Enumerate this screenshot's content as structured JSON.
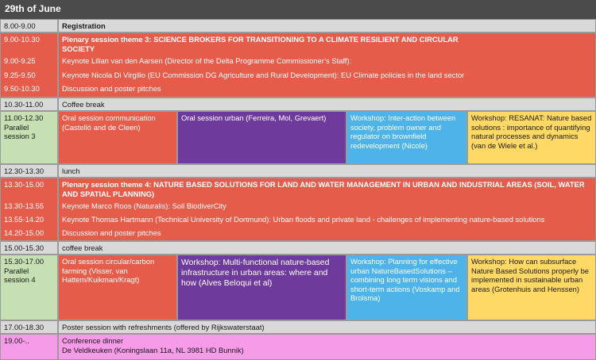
{
  "title": "29th of June",
  "colors": {
    "header": "#4b4b4b",
    "grey_row": "#d9d9d9",
    "plenary": "#e65c4a",
    "parallel_time": "#c6e0b4",
    "urban_session": "#6e3a9c",
    "workshop_blue": "#4db3e8",
    "workshop_yellow": "#ffd966",
    "dinner": "#f59be8"
  },
  "rows": {
    "registration": {
      "time": "8.00-9.00",
      "text": "Registration"
    },
    "plenary3": {
      "times": [
        "9.00-10.30",
        "9.00-9.25",
        "9.25-9.50",
        "9.50-10.30"
      ],
      "title": "Plenary session theme 3: SCIENCE BROKERS FOR TRANSITIONING TO A CLIMATE RESILIENT AND CIRCULAR SOCIETY",
      "items": [
        "Keynote Lilian van den Aarsen (Director of the Delta Programme Commissioner’s Staff):",
        "Keynote Nicola Di Virgilio (EU Commission DG Agriculture and Rural Development): EU Climate policies in the land sector",
        "Discussion and poster pitches"
      ]
    },
    "coffee1": {
      "time": "10.30-11.00",
      "text": "Coffee break"
    },
    "parallel3": {
      "time": "11.00-12.30",
      "label": "Parallel session 3",
      "cells": [
        "Oral session communication (Castelló and de Cleen)",
        "Oral session urban (Ferreira, Mol, Grevaert)",
        "Workshop: Inter-action between society, problem owner and regulator on brownfield redevelopment (Nicole)",
        "Workshop: RESANAT: Nature based solutions : importance of quantifying natural processes and dynamics (van de Wiele et al.)"
      ]
    },
    "lunch": {
      "time": "12.30-13.30",
      "text": "lunch"
    },
    "plenary4": {
      "times": [
        "13.30-15.00",
        "13.30-13.55",
        "13.55-14.20",
        "14.20-15.00"
      ],
      "title": "Plenary session theme 4: NATURE BASED SOLUTIONS FOR LAND AND WATER MANAGEMENT IN URBAN AND INDUSTRIAL AREAS (SOIL, WATER AND SPATIAL PLANNING)",
      "items": [
        "Keynote Marco Roos (Naturalis): Soil BiodiverCity",
        "Keynote Thomas Hartmann (Technical University of Dortmund): Urban floods and private land - challenges of implementing nature-based solutions",
        "Discussion and poster pitches"
      ]
    },
    "coffee2": {
      "time": "15.00-15.30",
      "text": "coffee break"
    },
    "parallel4": {
      "time": "15.30-17.00",
      "label": "Parallel session 4",
      "cells": [
        "Oral session circular/carbon farming (Visser, van Hattem/Kuikman/Kragt)",
        "Workshop: Multi-functional nature-based infrastructure in urban areas: where and how (Alves Beloqui et al)",
        "Workshop: Planning for effective urban NatureBasedSolutions – combining long term visions and short-term actions (Voskamp and Brolsma)",
        "Workshop: How can subsurface Nature Based Solutions properly be implemented in sustainable urban areas (Grotenhuis and Henssen)"
      ]
    },
    "poster": {
      "time": "17.00-18.30",
      "text": "Poster session with refreshments (offered by Rijkswaterstaat)"
    },
    "dinner": {
      "time": "19.00-..",
      "line1": "Conference dinner",
      "line2": "De Veldkeuken (Koningslaan 11a, NL 3981 HD Bunnik)"
    }
  }
}
